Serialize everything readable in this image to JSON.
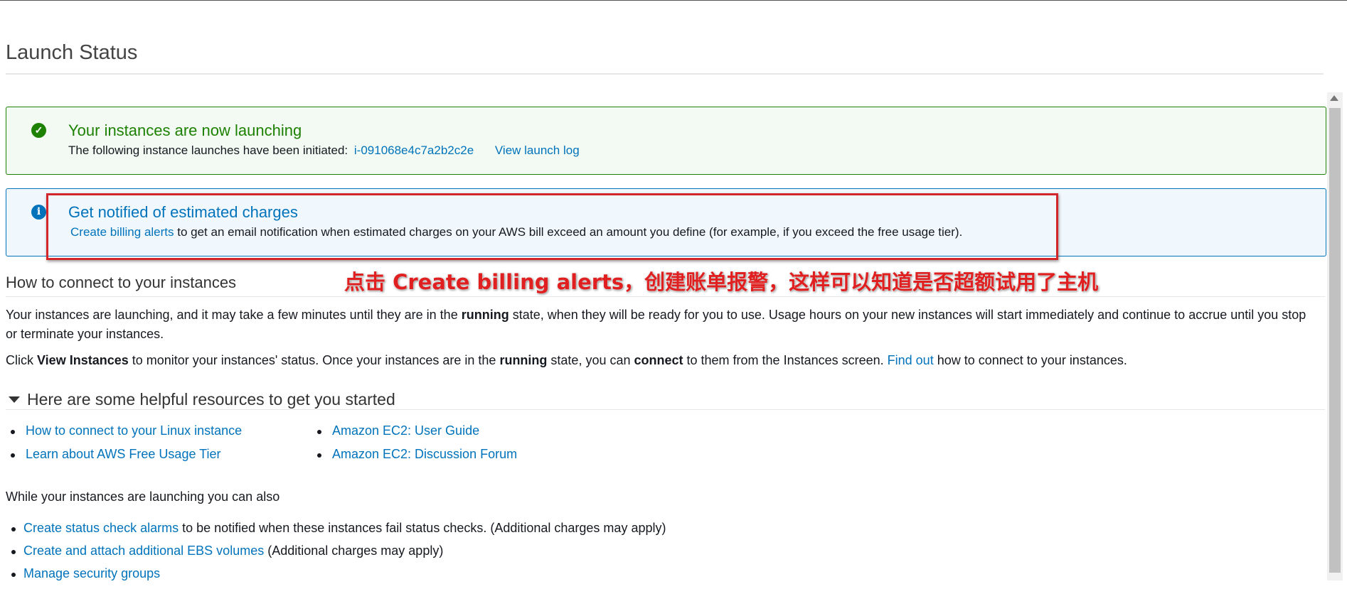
{
  "page_title": "Launch Status",
  "success_panel": {
    "title": "Your instances are now launching",
    "text": "The following instance launches have been initiated:",
    "instance_id": "i-091068e4c7a2b2c2e",
    "view_log_link": "View launch log"
  },
  "info_panel": {
    "title": "Get notified of estimated charges",
    "link": "Create billing alerts",
    "text": "to get an email notification when estimated charges on your AWS bill exceed an amount you define (for example, if you exceed the free usage tier)."
  },
  "annotation": "点击 Create billing alerts，创建账单报警，这样可以知道是否超额试用了主机",
  "connect_section": {
    "heading": "How to connect to your instances",
    "p1_a": "Your instances are launching, and it may take a few minutes until they are in the ",
    "p1_bold": "running",
    "p1_b": " state, when they will be ready for you to use. Usage hours on your new instances will start immediately and continue to accrue until you stop or terminate your instances.",
    "p2_a": "Click ",
    "p2_bold1": "View Instances",
    "p2_b": " to monitor your instances' status. Once your instances are in the ",
    "p2_bold2": "running",
    "p2_c": " state, you can ",
    "p2_bold3": "connect",
    "p2_d": " to them from the Instances screen. ",
    "p2_link": "Find out",
    "p2_e": " how to connect to your instances."
  },
  "resources": {
    "heading": "Here are some helpful resources to get you started",
    "col1": [
      "How to connect to your Linux instance",
      "Learn about AWS Free Usage Tier"
    ],
    "col2": [
      "Amazon EC2: User Guide",
      "Amazon EC2: Discussion Forum"
    ]
  },
  "also": {
    "intro": "While your instances are launching you can also",
    "items": [
      {
        "link": "Create status check alarms",
        "text": " to be notified when these instances fail status checks. (Additional charges may apply)"
      },
      {
        "link": "Create and attach additional EBS volumes",
        "text": " (Additional charges may apply)"
      },
      {
        "link": "Manage security groups",
        "text": ""
      }
    ]
  },
  "colors": {
    "success": "#1d8102",
    "info": "#0073bb",
    "annotation": "#e02020"
  }
}
